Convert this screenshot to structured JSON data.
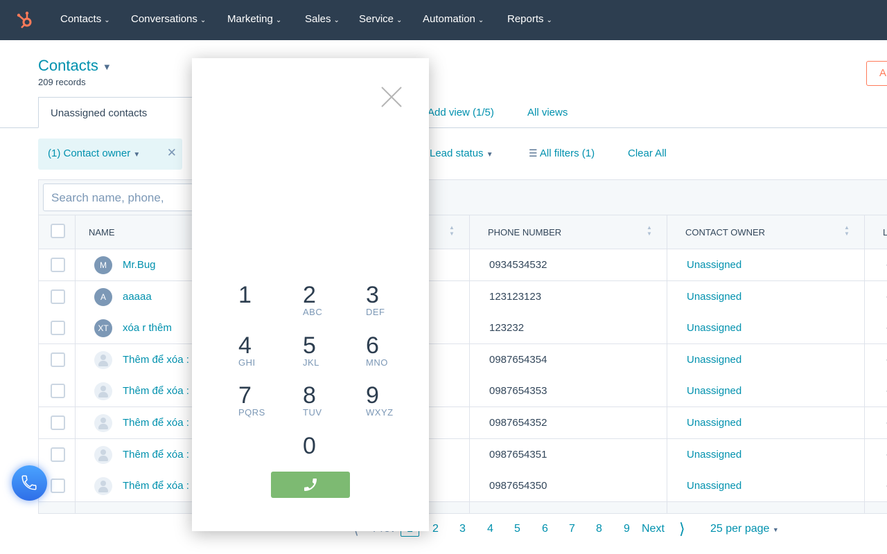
{
  "nav": {
    "items": [
      "Contacts",
      "Conversations",
      "Marketing",
      "Sales",
      "Service",
      "Automation",
      "Reports"
    ]
  },
  "header": {
    "title": "Contacts",
    "records": "209 records",
    "action_button": "A"
  },
  "views": {
    "active_tab": "Unassigned contacts",
    "add_view": "Add view (1/5)",
    "all_views": "All views"
  },
  "filters": {
    "owner_chip": "(1) Contact owner",
    "lead_status": "Lead status",
    "all_filters": "All filters (1)",
    "clear_all": "Clear All"
  },
  "search": {
    "placeholder": "Search name, phone,"
  },
  "table": {
    "columns": [
      "NAME",
      "PHONE NUMBER",
      "CONTACT OWNER",
      "L"
    ],
    "rows": [
      {
        "initials": "M",
        "name": "Mr.Bug",
        "phone": "0934534532",
        "owner": "Unassigned",
        "last": "-"
      },
      {
        "initials": "A",
        "name": "aaaaa",
        "phone": "123123123",
        "owner": "Unassigned",
        "last": "-"
      },
      {
        "initials": "XT",
        "name": "xóa r thêm",
        "phone": "123232",
        "owner": "Unassigned",
        "last": "-"
      },
      {
        "initials": "",
        "name": "Thêm để xóa :",
        "phone": "0987654354",
        "owner": "Unassigned",
        "last": "-"
      },
      {
        "initials": "",
        "name": "Thêm để xóa :",
        "phone": "0987654353",
        "owner": "Unassigned",
        "last": "-"
      },
      {
        "initials": "",
        "name": "Thêm để xóa :",
        "phone": "0987654352",
        "owner": "Unassigned",
        "last": "-"
      },
      {
        "initials": "",
        "name": "Thêm để xóa :",
        "phone": "0987654351",
        "owner": "Unassigned",
        "last": "-"
      },
      {
        "initials": "",
        "name": "Thêm để xóa :",
        "phone": "0987654350",
        "owner": "Unassigned",
        "last": "-"
      }
    ]
  },
  "pagination": {
    "prev": "Prev",
    "current": "1",
    "pages": [
      "2",
      "3",
      "4",
      "5",
      "6",
      "7",
      "8",
      "9"
    ],
    "next": "Next",
    "per_page": "25 per page"
  },
  "dialer": {
    "keys": [
      {
        "digit": "1",
        "letters": ""
      },
      {
        "digit": "2",
        "letters": "ABC"
      },
      {
        "digit": "3",
        "letters": "DEF"
      },
      {
        "digit": "4",
        "letters": "GHI"
      },
      {
        "digit": "5",
        "letters": "JKL"
      },
      {
        "digit": "6",
        "letters": "MNO"
      },
      {
        "digit": "7",
        "letters": "PQRS"
      },
      {
        "digit": "8",
        "letters": "TUV"
      },
      {
        "digit": "9",
        "letters": "WXYZ"
      },
      {
        "digit": "0",
        "letters": ""
      }
    ],
    "call_color": "#7dba72"
  },
  "colors": {
    "nav": "#2d3e50",
    "accent": "#0091ae",
    "brand": "#ff7a59"
  }
}
